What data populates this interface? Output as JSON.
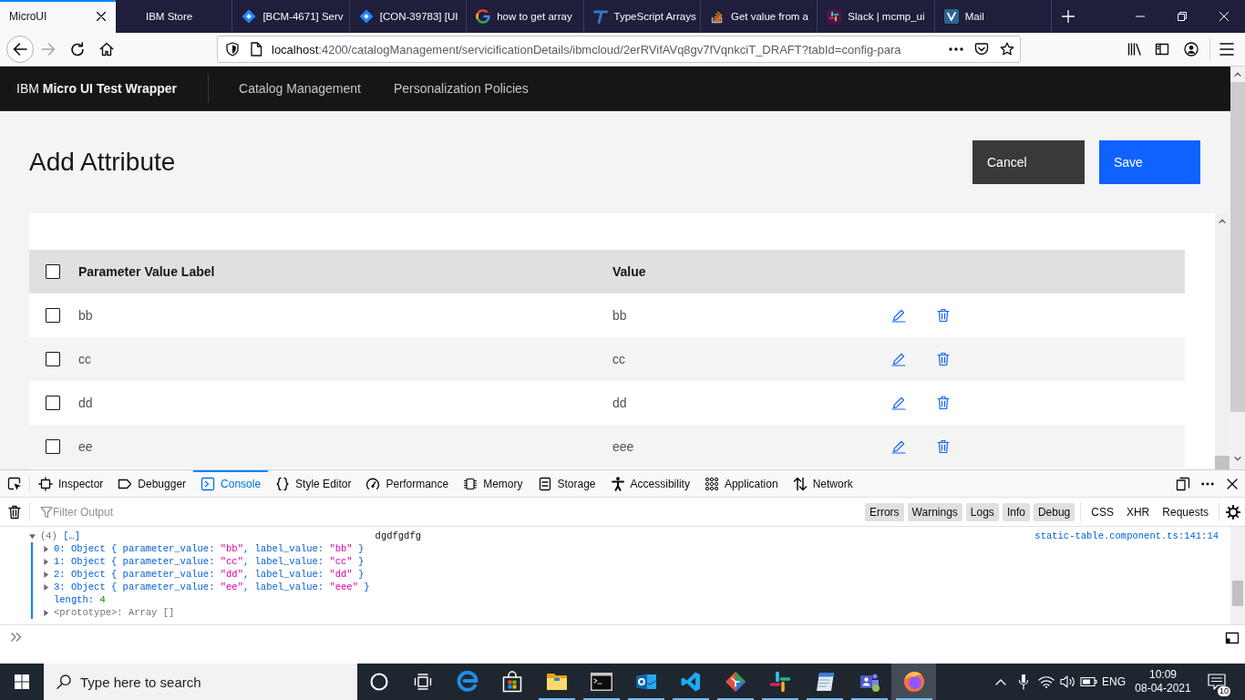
{
  "browser": {
    "tabs": [
      {
        "title": "MicroUI",
        "kind": "none",
        "selected": true
      },
      {
        "title": "IBM Store",
        "kind": "blank",
        "selected": false
      },
      {
        "title": "[BCM-4671] Serv",
        "kind": "diamond",
        "selected": false
      },
      {
        "title": "[CON-39783] [UI",
        "kind": "diamond",
        "selected": false
      },
      {
        "title": "how to get array",
        "kind": "gletter",
        "selected": false
      },
      {
        "title": "TypeScript Arrays",
        "kind": "tletter",
        "selected": false
      },
      {
        "title": "Get value from a",
        "kind": "stack",
        "selected": false
      },
      {
        "title": "Slack | mcmp_ui",
        "kind": "hash",
        "selected": false
      },
      {
        "title": "Mail",
        "kind": "vmark",
        "selected": false
      }
    ],
    "forward_disabled": true,
    "address": {
      "host": "localhost",
      "path": ":4200/catalogManagement/servicificationDetails/ibmcloud/2erRVifAVq8gv7fVqnkciT_DRAFT?tabId=config-para"
    }
  },
  "app": {
    "brand": "IBM **Micro UI Test Wrapper**",
    "nav": [
      "Catalog Management",
      "Personalization Policies"
    ]
  },
  "page": {
    "title": "Add Attribute",
    "actions": [
      {
        "label": "Cancel",
        "kind": "secondary"
      },
      {
        "label": "Save",
        "kind": "primary"
      }
    ]
  },
  "table": {
    "select_all": {
      "checked": false
    },
    "columns": [
      "Parameter Value Label",
      "Value"
    ],
    "rows": [
      {
        "checked": false,
        "label": "bb",
        "value": "bb"
      },
      {
        "checked": false,
        "label": "cc",
        "value": "cc"
      },
      {
        "checked": false,
        "label": "dd",
        "value": "dd"
      },
      {
        "checked": false,
        "label": "ee",
        "value": "eee"
      }
    ]
  },
  "devtools": {
    "tabs": [
      {
        "label": "Inspector",
        "kind": "inspector",
        "selected": false
      },
      {
        "label": "Debugger",
        "kind": "debugger",
        "selected": false
      },
      {
        "label": "Console",
        "kind": "console",
        "selected": true
      },
      {
        "label": "Style Editor",
        "kind": "style",
        "selected": false
      },
      {
        "label": "Performance",
        "kind": "performance",
        "selected": false
      },
      {
        "label": "Memory",
        "kind": "memory",
        "selected": false
      },
      {
        "label": "Storage",
        "kind": "storage",
        "selected": false
      },
      {
        "label": "Accessibility",
        "kind": "accessibility",
        "selected": false
      },
      {
        "label": "Application",
        "kind": "application",
        "selected": false
      },
      {
        "label": "Network",
        "kind": "network",
        "selected": false
      }
    ],
    "filter": {
      "placeholder": "Filter Output"
    },
    "levels": [
      {
        "label": "Errors",
        "selected": true
      },
      {
        "label": "Warnings",
        "selected": true
      },
      {
        "label": "Logs",
        "selected": true
      },
      {
        "label": "Info",
        "selected": true
      },
      {
        "label": "Debug",
        "selected": true
      }
    ],
    "request_filters": [
      {
        "label": "CSS",
        "selected": false
      },
      {
        "label": "XHR",
        "selected": false
      },
      {
        "label": "Requests",
        "selected": false
      }
    ],
    "console": {
      "entries": [
        {
          "expanded": true,
          "summary": [
            {
              "text": "(4)",
              "kind": "muted"
            },
            {
              "text": "[…]",
              "kind": "key"
            }
          ],
          "message": "dgdfgdfg",
          "source": "static-table.component.ts:141:14",
          "children": [
            {
              "kind": "object",
              "expanded": false,
              "tokens": [
                {
                  "text": "0: Object { parameter_value: ",
                  "kind": "key"
                },
                {
                  "text": "\"bb\"",
                  "kind": "string"
                },
                {
                  "text": ", label_value: ",
                  "kind": "key"
                },
                {
                  "text": "\"bb\"",
                  "kind": "string"
                },
                {
                  "text": " }",
                  "kind": "key"
                }
              ]
            },
            {
              "kind": "object",
              "expanded": false,
              "tokens": [
                {
                  "text": "1: Object { parameter_value: ",
                  "kind": "key"
                },
                {
                  "text": "\"cc\"",
                  "kind": "string"
                },
                {
                  "text": ", label_value: ",
                  "kind": "key"
                },
                {
                  "text": "\"cc\"",
                  "kind": "string"
                },
                {
                  "text": " }",
                  "kind": "key"
                }
              ]
            },
            {
              "kind": "object",
              "expanded": false,
              "tokens": [
                {
                  "text": "2: Object { parameter_value: ",
                  "kind": "key"
                },
                {
                  "text": "\"dd\"",
                  "kind": "string"
                },
                {
                  "text": ", label_value: ",
                  "kind": "key"
                },
                {
                  "text": "\"dd\"",
                  "kind": "string"
                },
                {
                  "text": " }",
                  "kind": "key"
                }
              ]
            },
            {
              "kind": "object",
              "expanded": false,
              "tokens": [
                {
                  "text": "3: Object { parameter_value: ",
                  "kind": "key"
                },
                {
                  "text": "\"ee\"",
                  "kind": "string"
                },
                {
                  "text": ", label_value: ",
                  "kind": "key"
                },
                {
                  "text": "\"eee\"",
                  "kind": "string"
                },
                {
                  "text": " }",
                  "kind": "key"
                }
              ]
            },
            {
              "kind": "property",
              "tokens": [
                {
                  "text": "length: ",
                  "kind": "key"
                },
                {
                  "text": "4",
                  "kind": "number"
                }
              ]
            },
            {
              "kind": "object",
              "expanded": false,
              "tokens": [
                {
                  "text": "<prototype>: Array []",
                  "kind": "muted"
                }
              ]
            }
          ]
        }
      ]
    }
  },
  "taskbar": {
    "search": {
      "placeholder": "Type here to search"
    },
    "apps": [
      {
        "kind": "edge",
        "running": false,
        "selected": false
      },
      {
        "kind": "store",
        "running": false,
        "selected": false
      },
      {
        "kind": "explorer",
        "running": true,
        "selected": false
      },
      {
        "kind": "terminal",
        "running": true,
        "selected": false
      },
      {
        "kind": "outlook",
        "running": true,
        "selected": false
      },
      {
        "kind": "vscode",
        "running": true,
        "selected": false
      },
      {
        "kind": "git",
        "running": true,
        "selected": false
      },
      {
        "kind": "slack",
        "running": true,
        "selected": false
      },
      {
        "kind": "notes",
        "running": true,
        "selected": false
      },
      {
        "kind": "teams",
        "running": true,
        "selected": false
      },
      {
        "kind": "firefox",
        "running": true,
        "selected": true
      }
    ],
    "language": "ENG",
    "time": "10:09",
    "date": "08-04-2021",
    "notifications": "10"
  }
}
